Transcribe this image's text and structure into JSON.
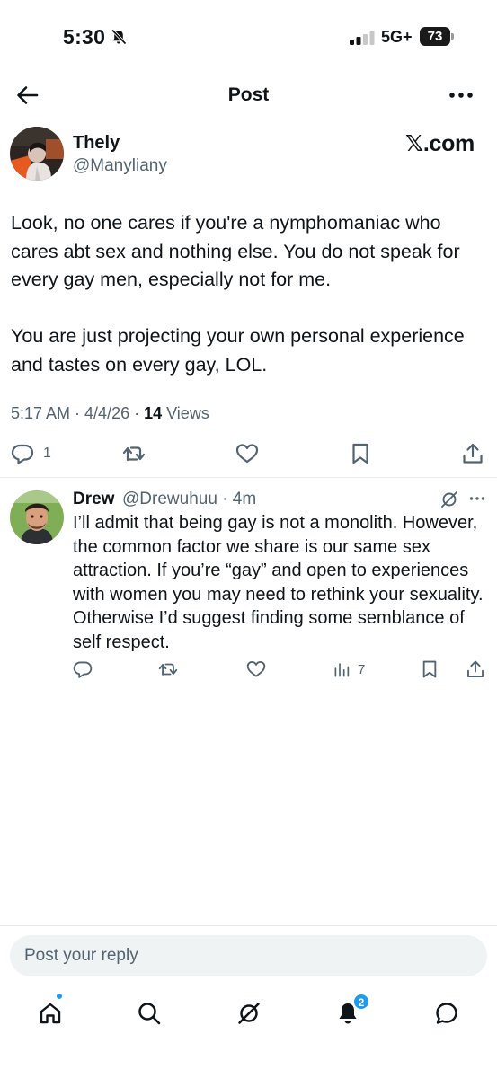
{
  "status_bar": {
    "time": "5:30",
    "network": "5G+",
    "battery": "73",
    "icons": [
      "bell-mute-icon",
      "signal-bars-icon",
      "battery-icon"
    ]
  },
  "header": {
    "title": "Post",
    "icons": [
      "back-arrow-icon",
      "more-horizontal-icon"
    ]
  },
  "post": {
    "author_name": "Thely",
    "author_handle": "@Manyliany",
    "watermark": "𝕏.com",
    "paragraphs": [
      "Look, no one cares if you're a nymphomaniac who cares abt sex and nothing else. You do not speak for every gay men, especially not for me.",
      "You are just projecting your own personal experience and tastes on every gay, LOL."
    ],
    "time": "5:17 AM",
    "date": "4/4/26",
    "separator": " · ",
    "views_count": "14",
    "views_label": " Views",
    "actions": {
      "reply_count": "1",
      "icons": [
        "reply-icon",
        "repost-icon",
        "like-icon",
        "bookmark-icon",
        "share-icon"
      ]
    }
  },
  "reply": {
    "author_name": "Drew",
    "handle_time": "@Drewuhuu · 4m",
    "text": "I’ll admit that being gay is not a monolith. However, the common factor we share is our same sex attraction. If you’re “gay” and open to experiences with women you may need to rethink your sexuality. Otherwise I’d suggest finding some semblance of self respect.",
    "views_count": "7",
    "icons": [
      "grok-icon",
      "more-horizontal-icon",
      "reply-icon",
      "repost-icon",
      "like-icon",
      "views-icon",
      "bookmark-icon",
      "share-icon"
    ]
  },
  "compose": {
    "placeholder": "Post your reply"
  },
  "bottom_nav": {
    "notification_badge": "2",
    "icons": [
      "home-icon",
      "search-icon",
      "grok-icon",
      "notifications-icon",
      "messages-icon"
    ]
  },
  "colors": {
    "text_primary": "#0f1419",
    "text_secondary": "#536471",
    "accent": "#1d9bf0",
    "input_bg": "#eff3f4"
  }
}
